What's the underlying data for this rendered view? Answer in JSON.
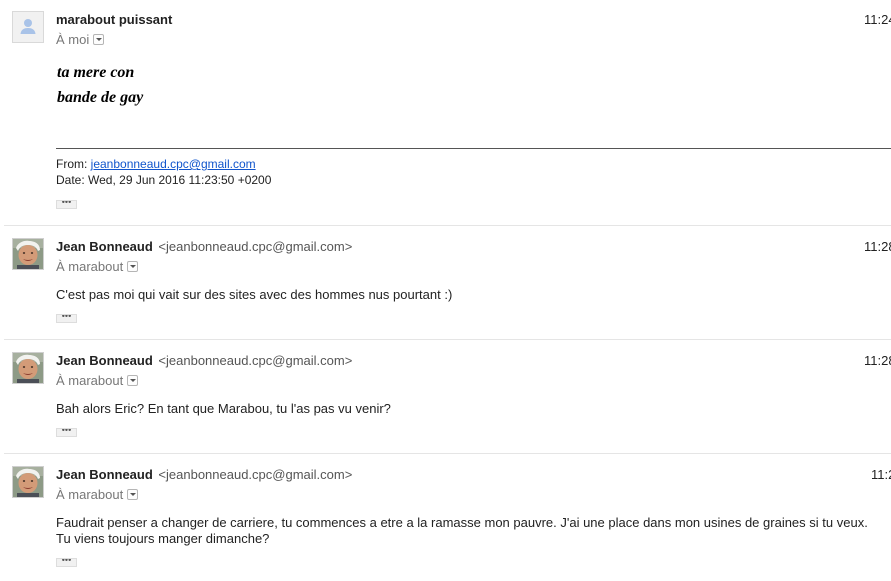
{
  "messages": [
    {
      "sender_name": "marabout puissant",
      "sender_email": "",
      "time": "11:24",
      "recipient": "À moi",
      "body_lines": [
        "ta mere con",
        "bande de gay"
      ],
      "quoted": {
        "from_label": "From: ",
        "from_address": "jeanbonneaud.cpc@gmail.com",
        "date_line": "Date: Wed, 29 Jun 2016 11:23:50 +0200"
      },
      "ellipsis": "•••"
    },
    {
      "sender_name": "Jean Bonneaud",
      "sender_email": "<jeanbonneaud.cpc@gmail.com>",
      "time": "11:28",
      "recipient": "À marabout",
      "body_lines": [
        "C'est pas moi qui vait sur des sites avec des hommes nus pourtant :)"
      ],
      "ellipsis": "•••"
    },
    {
      "sender_name": "Jean Bonneaud",
      "sender_email": "<jeanbonneaud.cpc@gmail.com>",
      "time": "11:28",
      "recipient": "À marabout",
      "body_lines": [
        "Bah alors Eric? En tant que Marabou, tu l'as pas vu venir?"
      ],
      "ellipsis": "•••"
    },
    {
      "sender_name": "Jean Bonneaud",
      "sender_email": "<jeanbonneaud.cpc@gmail.com>",
      "time": "11:2",
      "recipient": "À marabout",
      "body_lines": [
        "Faudrait penser a changer de carriere, tu commences a etre a la ramasse mon pauvre. J'ai une place dans mon usines de graines si tu veux.",
        "Tu viens toujours manger dimanche?"
      ],
      "ellipsis": "•••"
    }
  ],
  "colors": {
    "link": "#1155cc",
    "divider": "#e5e5e5",
    "muted": "#777777"
  },
  "icons": {
    "blank_avatar": "person-silhouette-icon",
    "photo_avatar": "sender-photo",
    "recipient_dropdown": "chevron-down-icon",
    "trimmed_content": "ellipsis-icon"
  }
}
